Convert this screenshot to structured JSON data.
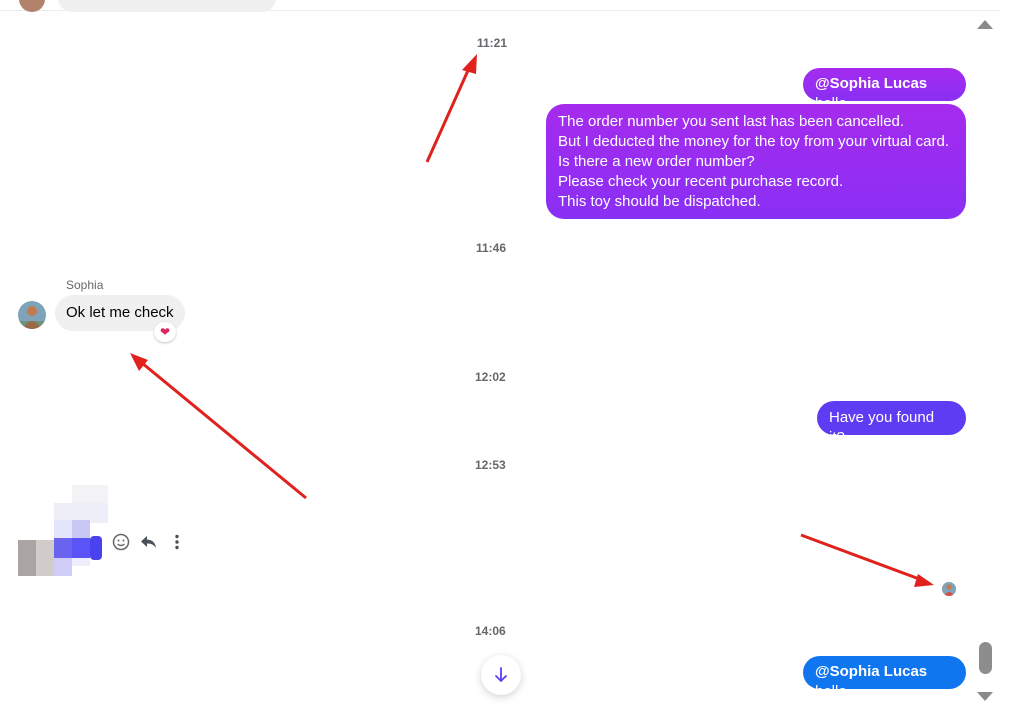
{
  "timestamps": {
    "t1": "11:21",
    "t2": "11:46",
    "t3": "12:02",
    "t4": "12:53",
    "t5": "14:06"
  },
  "messages": {
    "m1": {
      "mention": "@Sophia Lucas",
      "text": " hello"
    },
    "m2": {
      "lines": [
        "The order number you sent last has been cancelled.",
        "But I deducted the money for the toy from your virtual card.",
        "Is there a new order number?",
        "Please check your recent purchase record.",
        "This toy should be dispatched."
      ]
    },
    "incoming": {
      "sender": "Sophia",
      "text": "Ok let me check",
      "reaction": "❤"
    },
    "m3": {
      "text": "Have you found it?"
    },
    "m4": {
      "mention": "@Sophia Lucas",
      "text": " hello"
    }
  },
  "colors": {
    "purple": "#9a2ef2",
    "indigo": "#5e3cf3",
    "blue": "#0f76f0",
    "annotation_arrow": "#e0211d"
  },
  "icons": {
    "emoji": "emoji-icon",
    "reply": "reply-icon",
    "more": "more-icon",
    "scroll_down": "arrow-down-icon"
  }
}
